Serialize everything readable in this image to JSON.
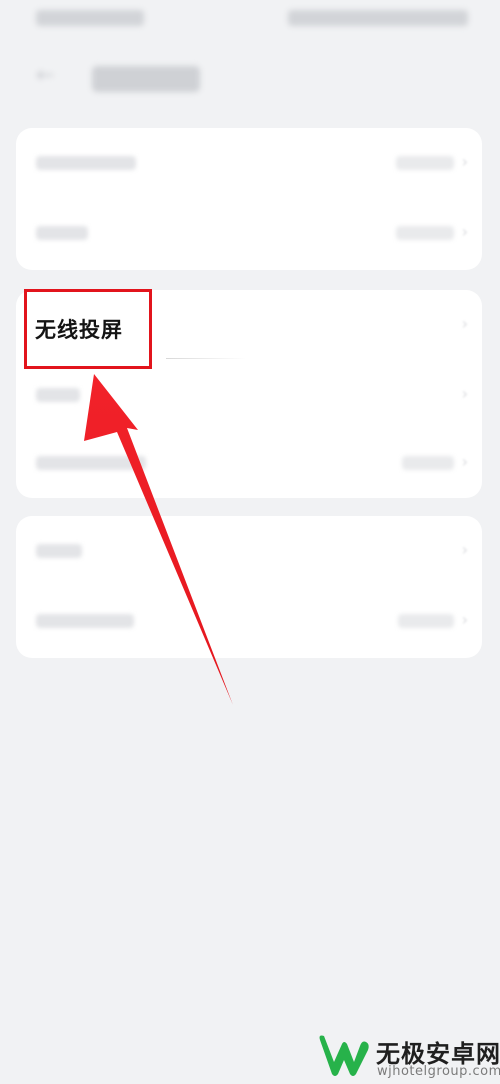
{
  "screen": {
    "wireless_projection_label": "无线投屏"
  },
  "annotation": {
    "highlight_color": "#e2141c",
    "arrow_color": "#ef1d24"
  },
  "watermark": {
    "brand_text": "无极安卓网",
    "url_text": "wjhotelgroup.com",
    "logo_color": "#27b24a"
  }
}
